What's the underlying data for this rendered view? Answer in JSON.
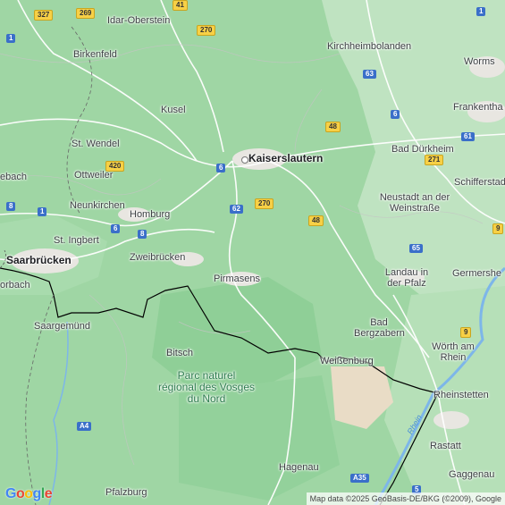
{
  "map": {
    "places": [
      {
        "id": "idar-oberstein",
        "text": "Idar-Oberstein"
      },
      {
        "id": "birkenfeld",
        "text": "Birkenfeld"
      },
      {
        "id": "kirchheimbolanden",
        "text": "Kirchheimbolanden"
      },
      {
        "id": "worms",
        "text": "Worms"
      },
      {
        "id": "frankenthal",
        "text": "Frankentha"
      },
      {
        "id": "kusel",
        "text": "Kusel"
      },
      {
        "id": "st-wendel",
        "text": "St. Wendel"
      },
      {
        "id": "ottweiler",
        "text": "Ottweiler"
      },
      {
        "id": "kaiserslautern",
        "text": "Kaiserslautern"
      },
      {
        "id": "bad-durkheim",
        "text": "Bad Dürkheim"
      },
      {
        "id": "schifferstadt",
        "text": "Schifferstad"
      },
      {
        "id": "ebach",
        "text": "ebach"
      },
      {
        "id": "neunkirchen",
        "text": "Neunkirchen"
      },
      {
        "id": "homburg",
        "text": "Homburg"
      },
      {
        "id": "neustadt",
        "text": "Neustadt an der Weinstraße"
      },
      {
        "id": "st-ingbert",
        "text": "St. Ingbert"
      },
      {
        "id": "saarbrucken",
        "text": "Saarbrücken"
      },
      {
        "id": "zweibrucken",
        "text": "Zweibrücken"
      },
      {
        "id": "germersheim",
        "text": "Germershe"
      },
      {
        "id": "forbach",
        "text": "orbach"
      },
      {
        "id": "pirmasens",
        "text": "Pirmasens"
      },
      {
        "id": "landau",
        "text": "Landau in der Pfalz"
      },
      {
        "id": "sarreguemines",
        "text": "Saargemünd"
      },
      {
        "id": "bad-bergzabern",
        "text": "Bad Bergzabern"
      },
      {
        "id": "bitsch",
        "text": "Bitsch"
      },
      {
        "id": "weissenburg",
        "text": "Weißenburg"
      },
      {
        "id": "worth",
        "text": "Wörth am Rhein"
      },
      {
        "id": "rheinstetten",
        "text": "Rheinstetten"
      },
      {
        "id": "rastatt",
        "text": "Rastatt"
      },
      {
        "id": "gaggenau",
        "text": "Gaggenau"
      },
      {
        "id": "hagenau",
        "text": "Hagenau"
      },
      {
        "id": "pfalzburg",
        "text": "Pfalzburg"
      }
    ],
    "park_label": "Parc naturel régional des Vosges du Nord",
    "river_label": "Rhein",
    "shields": [
      {
        "id": "327",
        "text": "327",
        "style": "yellow"
      },
      {
        "id": "269",
        "text": "269",
        "style": "yellow"
      },
      {
        "id": "41",
        "text": "41",
        "style": "yellow"
      },
      {
        "id": "270-north",
        "text": "270",
        "style": "yellow"
      },
      {
        "id": "1-nw",
        "text": "1",
        "style": "blue"
      },
      {
        "id": "63",
        "text": "63",
        "style": "blue"
      },
      {
        "id": "48-north",
        "text": "48",
        "style": "yellow"
      },
      {
        "id": "6-east",
        "text": "6",
        "style": "blue"
      },
      {
        "id": "61",
        "text": "61",
        "style": "blue"
      },
      {
        "id": "420",
        "text": "420",
        "style": "yellow"
      },
      {
        "id": "6-kl",
        "text": "6",
        "style": "blue"
      },
      {
        "id": "271",
        "text": "271",
        "style": "yellow"
      },
      {
        "id": "8-west",
        "text": "8",
        "style": "blue"
      },
      {
        "id": "62",
        "text": "62",
        "style": "blue"
      },
      {
        "id": "270-south",
        "text": "270",
        "style": "yellow"
      },
      {
        "id": "1-west",
        "text": "1",
        "style": "blue"
      },
      {
        "id": "48-south",
        "text": "48",
        "style": "yellow"
      },
      {
        "id": "6-homburg",
        "text": "6",
        "style": "blue"
      },
      {
        "id": "8-zwei",
        "text": "8",
        "style": "blue"
      },
      {
        "id": "65",
        "text": "65",
        "style": "blue"
      },
      {
        "id": "9-ne",
        "text": "9",
        "style": "yellow"
      },
      {
        "id": "9-se",
        "text": "9",
        "style": "yellow"
      },
      {
        "id": "a4",
        "text": "A4",
        "style": "blue"
      },
      {
        "id": "a35",
        "text": "A35",
        "style": "blue"
      },
      {
        "id": "5",
        "text": "5",
        "style": "blue"
      },
      {
        "id": "1-topright",
        "text": "1",
        "style": "blue"
      }
    ],
    "attribution": "Map data ©2025 GeoBasis-DE/BKG (©2009), Google",
    "logo": [
      "G",
      "o",
      "o",
      "g",
      "l",
      "e"
    ],
    "colors": {
      "land": "#9fd6a4",
      "forest": "#8fcf97",
      "farmland": "#bfe3c1",
      "urban": "#e8e6e1",
      "roads": "#ffffff",
      "border": "#000000",
      "river": "#7db6e9",
      "sandstone": "#e9dcc6"
    }
  }
}
